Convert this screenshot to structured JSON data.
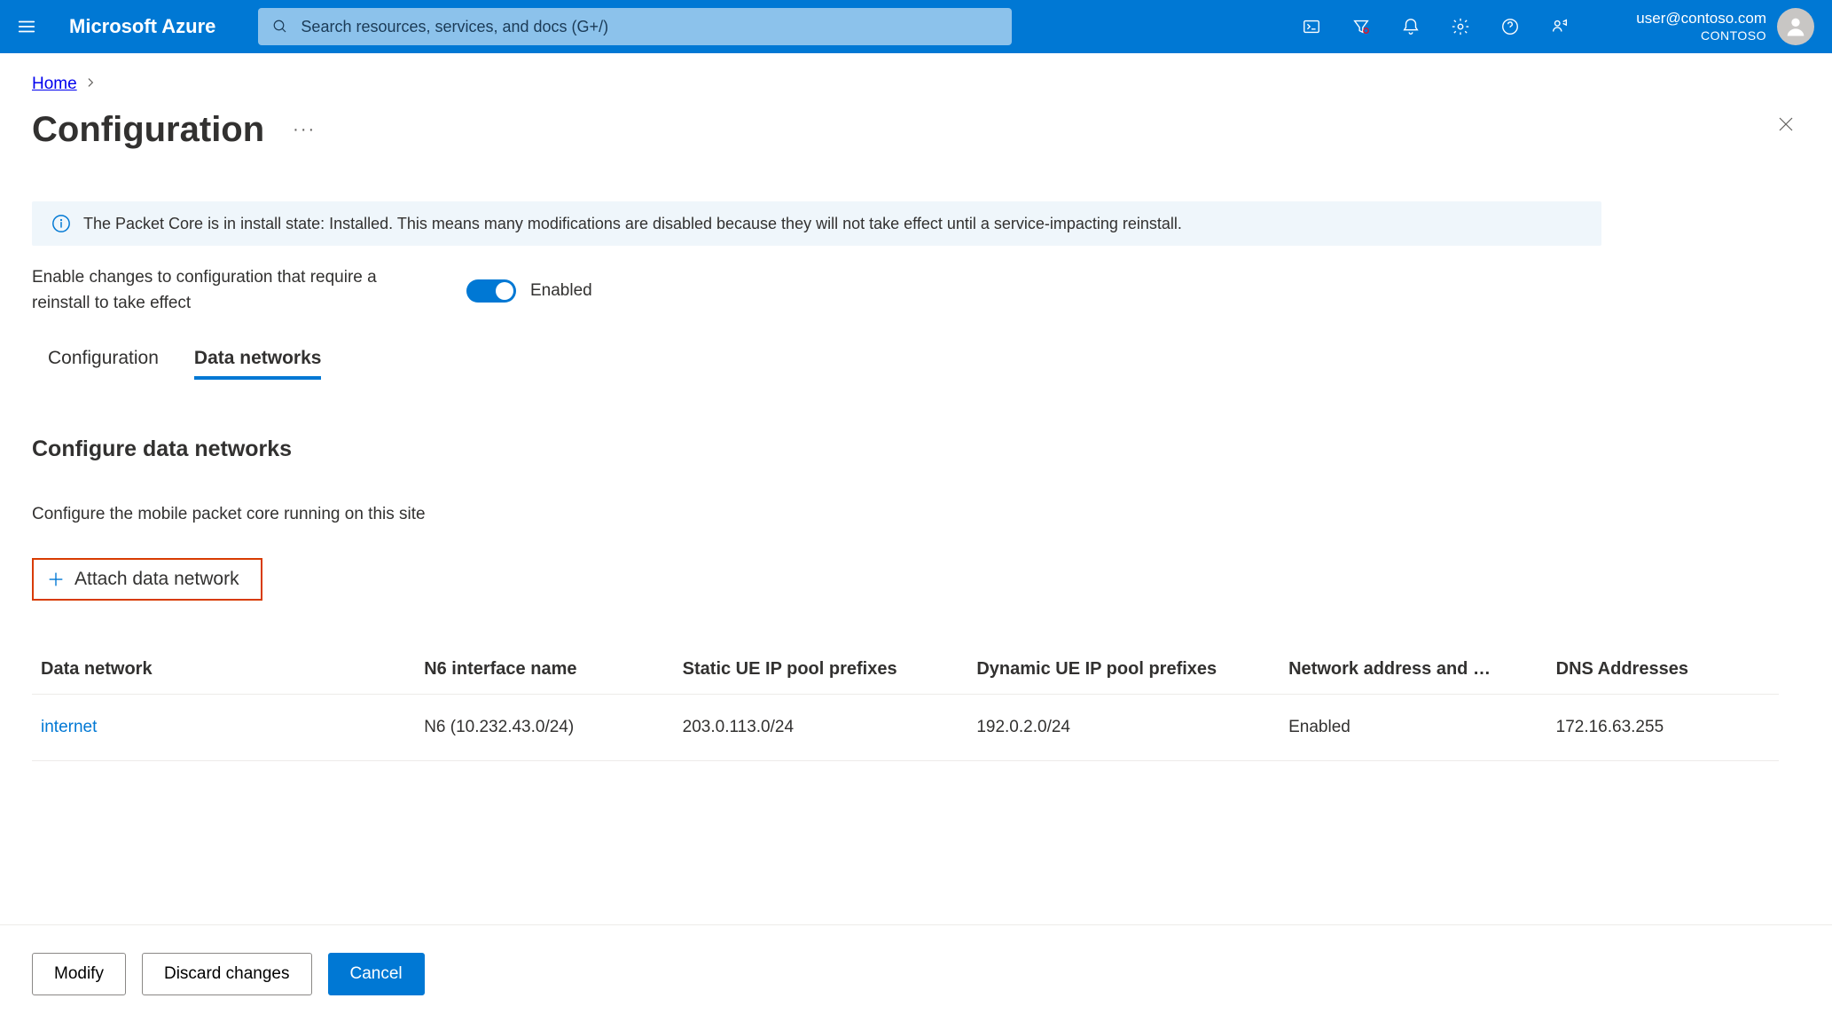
{
  "header": {
    "brand": "Microsoft Azure",
    "search_placeholder": "Search resources, services, and docs (G+/)",
    "account": {
      "email": "user@contoso.com",
      "tenant": "CONTOSO"
    }
  },
  "breadcrumb": {
    "items": [
      "Home"
    ]
  },
  "page": {
    "title": "Configuration",
    "info_banner": "The Packet Core is in install state: Installed. This means many modifications are disabled because they will not take effect until a service-impacting reinstall.",
    "toggle_label": "Enable changes to configuration that require a reinstall to take effect",
    "toggle_state": "Enabled",
    "tabs": [
      "Configuration",
      "Data networks"
    ],
    "active_tab": 1,
    "section_title": "Configure data networks",
    "section_sub": "Configure the mobile packet core running on this site",
    "attach_label": "Attach data network",
    "table": {
      "columns": [
        "Data network",
        "N6 interface name",
        "Static UE IP pool prefixes",
        "Dynamic UE IP pool prefixes",
        "Network address and …",
        "DNS Addresses"
      ],
      "rows": [
        {
          "name": "internet",
          "n6": "N6 (10.232.43.0/24)",
          "static": "203.0.113.0/24",
          "dynamic": "192.0.2.0/24",
          "nat": "Enabled",
          "dns": "172.16.63.255"
        }
      ]
    }
  },
  "footer": {
    "modify": "Modify",
    "discard": "Discard changes",
    "cancel": "Cancel"
  }
}
